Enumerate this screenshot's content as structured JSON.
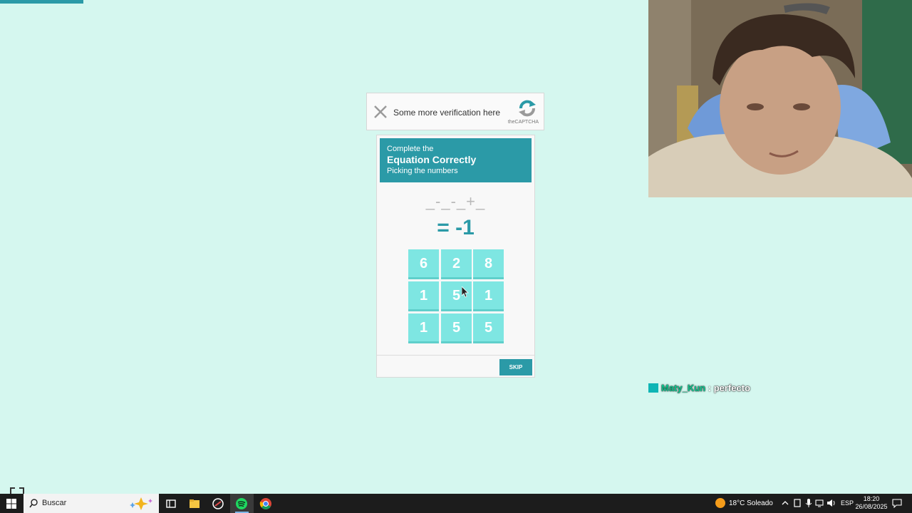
{
  "captcha": {
    "label": "Some more verification here",
    "brand": "theCAPTCHA"
  },
  "challenge": {
    "header_line1": "Complete the",
    "header_line2": "Equation Correctly",
    "header_line3": "Picking the numbers",
    "equation_slots": "_-_-_+_",
    "equation_result": "= -1",
    "tiles": [
      "6",
      "2",
      "8",
      "1",
      "5",
      "1",
      "1",
      "5",
      "5"
    ],
    "skip_label": "SKIP"
  },
  "chat": {
    "user": "Maty_Kun",
    "separator": ":",
    "message": "perfecto"
  },
  "taskbar": {
    "search_placeholder": "Buscar",
    "weather": "18°C  Soleado",
    "language": "ESP",
    "time": "18:20",
    "date": "26/08/2025"
  },
  "colors": {
    "background": "#d5f7ef",
    "accent": "#2b9aa7",
    "tile": "#7ee6e2",
    "chat_user": "#11c48e"
  }
}
